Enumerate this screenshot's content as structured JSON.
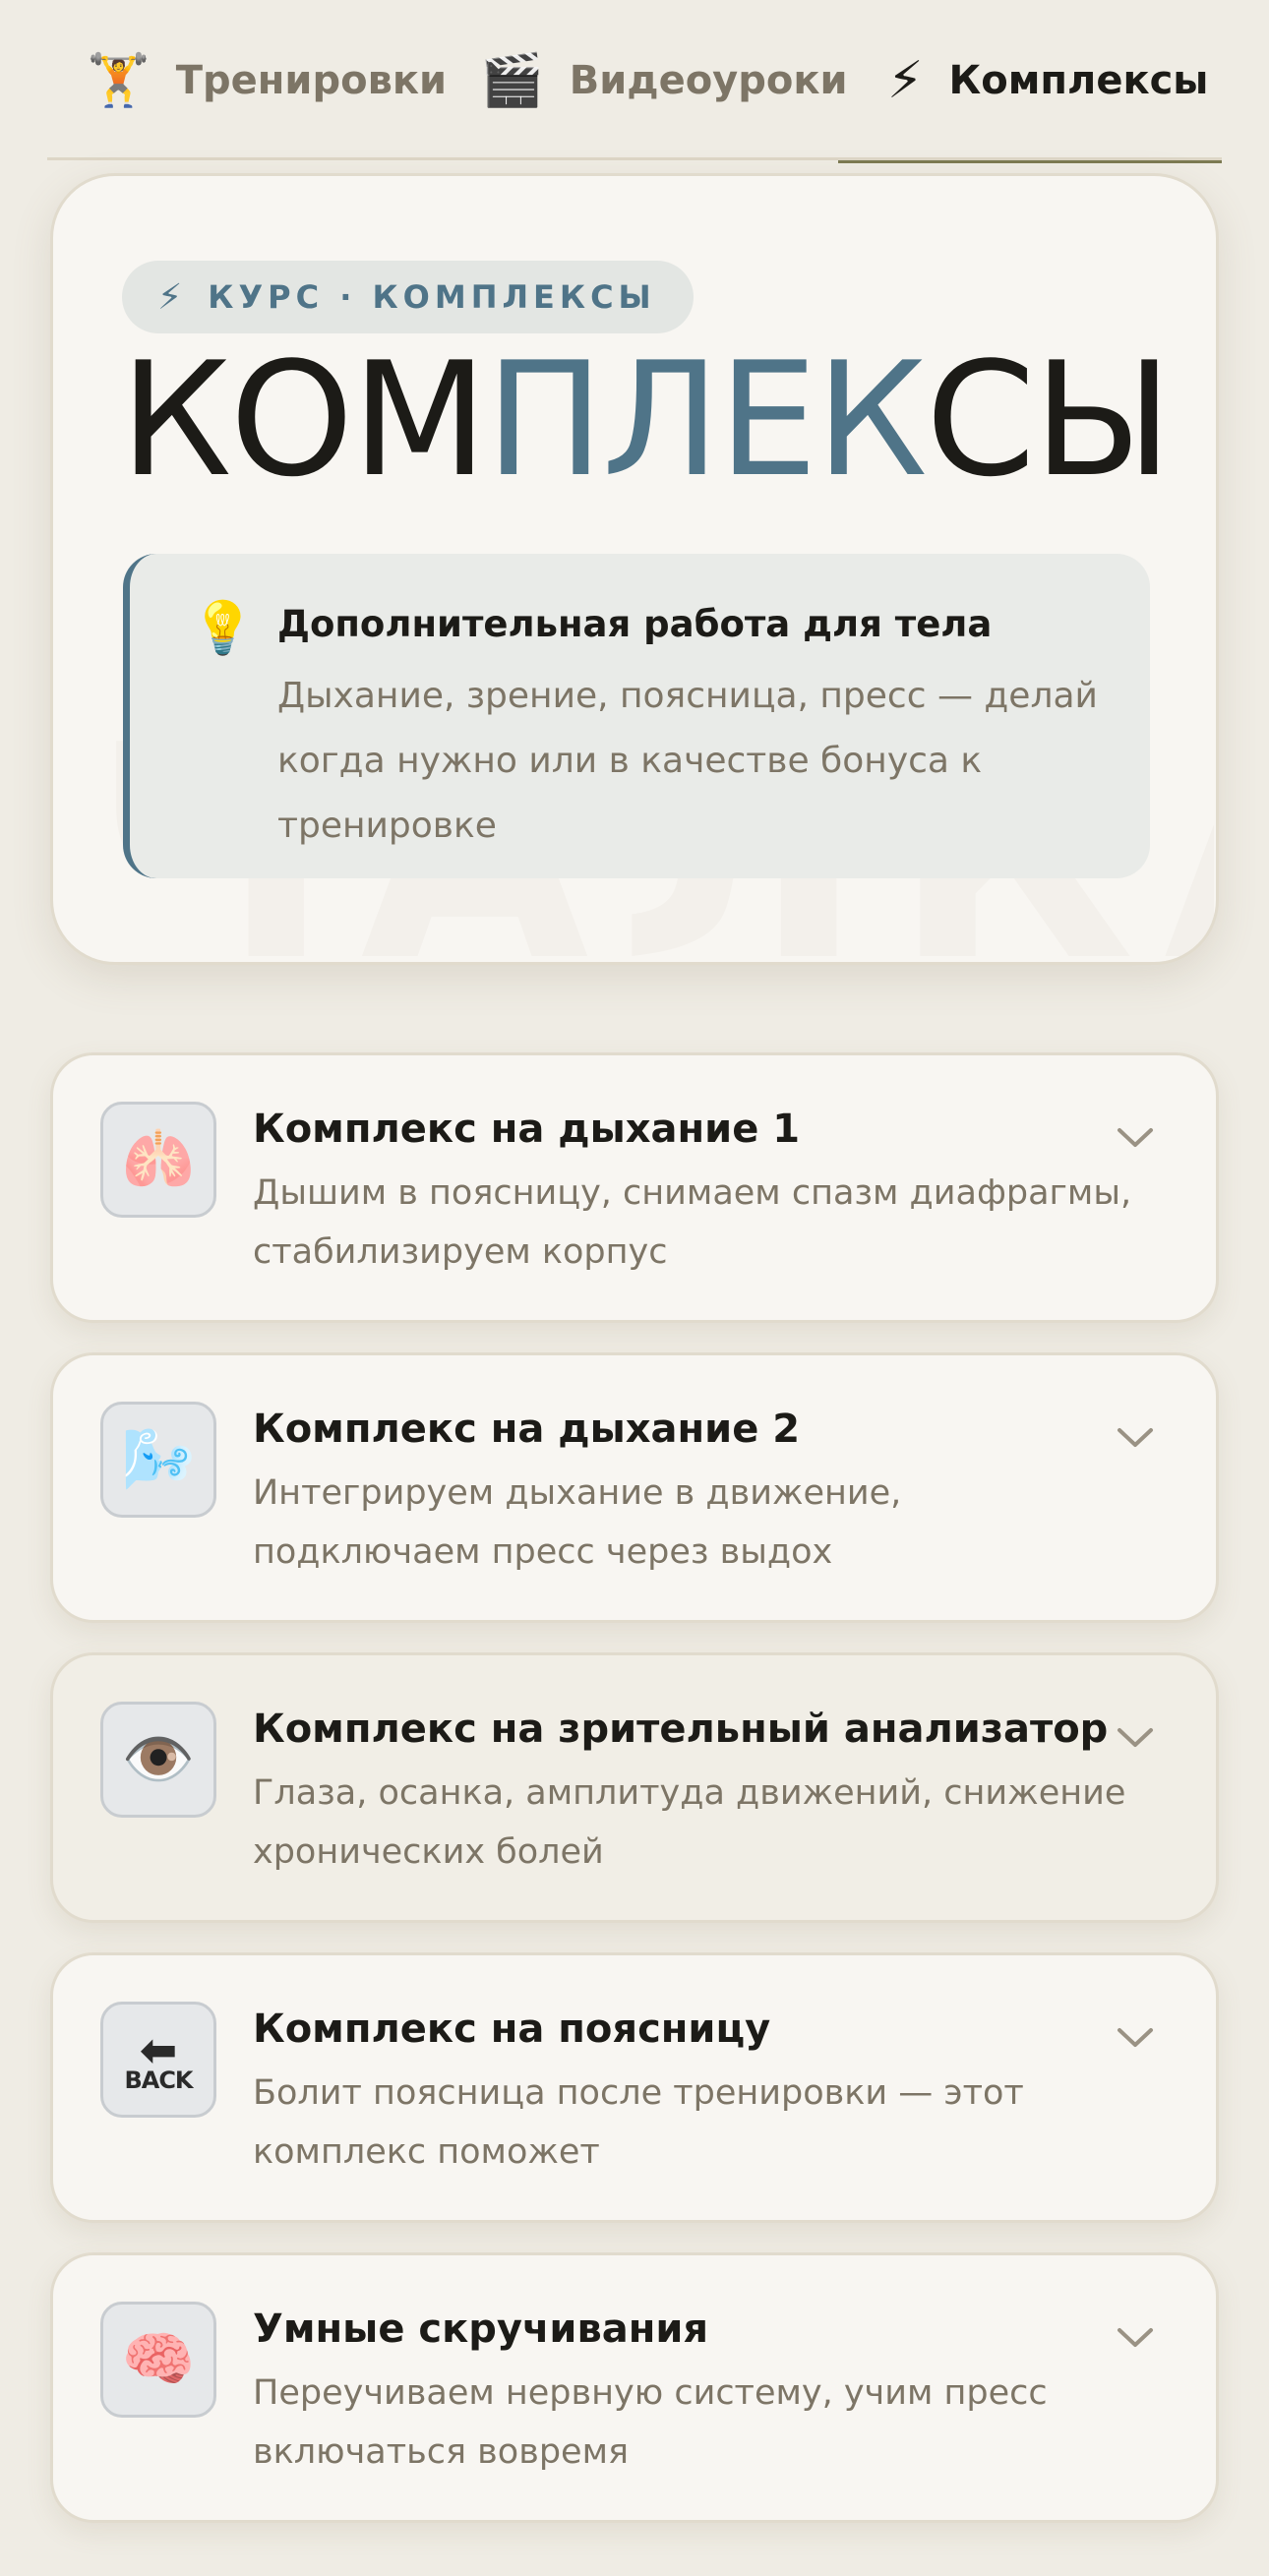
{
  "tabs": [
    {
      "icon": "🏋",
      "icon_name": "weightlifter-icon",
      "label": "Тренировки",
      "active": false
    },
    {
      "icon": "🎬",
      "icon_name": "clapperboard-icon",
      "label": "Видеоуроки",
      "active": false
    },
    {
      "icon": "⚡",
      "icon_name": "lightning-icon",
      "label": "Комплексы",
      "active": true
    }
  ],
  "hero": {
    "pill_icon": "⚡",
    "pill_icon_name": "lightning-icon",
    "pill_label": "КУРС · КОМПЛЕКСЫ",
    "title_part1": "КОМ",
    "title_part2": "ПЛЕК",
    "title_part3": "СЫ",
    "watermark": "ЧАЛКА",
    "callout_icon": "💡",
    "callout_icon_name": "lightbulb-icon",
    "callout_title": "Дополнительная работа для тела",
    "callout_text": "Дыхание, зрение, поясница, пресс — делай когда нужно или в качестве бонуса к тренировке"
  },
  "complexes": [
    {
      "icon": "🫁",
      "icon_name": "lungs-icon",
      "title": "Комплекс на дыхание 1",
      "description": "Дышим в поясницу, снимаем спазм диафрагмы, стабилизируем корпус"
    },
    {
      "icon": "🌬️",
      "icon_name": "wind-face-icon",
      "title": "Комплекс на дыхание 2",
      "description": "Интегрируем дыхание в движение, подключаем пресс через выдох"
    },
    {
      "icon": "👁️",
      "icon_name": "eye-icon",
      "title": "Комплекс на зрительный анализатор",
      "description": "Глаза, осанка, амплитуда движений, снижение хронических болей"
    },
    {
      "icon": "BACK",
      "icon_name": "back-arrow-icon",
      "title": "Комплекс на поясницу",
      "description": "Болит поясница после тренировки — этот комплекс поможет"
    },
    {
      "icon": "🧠",
      "icon_name": "brain-icon",
      "title": "Умные скручивания",
      "description": "Переучиваем нервную систему, учим пресс включаться вовремя"
    }
  ],
  "colors": {
    "accent": "#4f7488",
    "background": "#efece4",
    "card": "#f8f6f2",
    "muted_text": "#7d7566",
    "tab_underline": "#7c7a52"
  }
}
